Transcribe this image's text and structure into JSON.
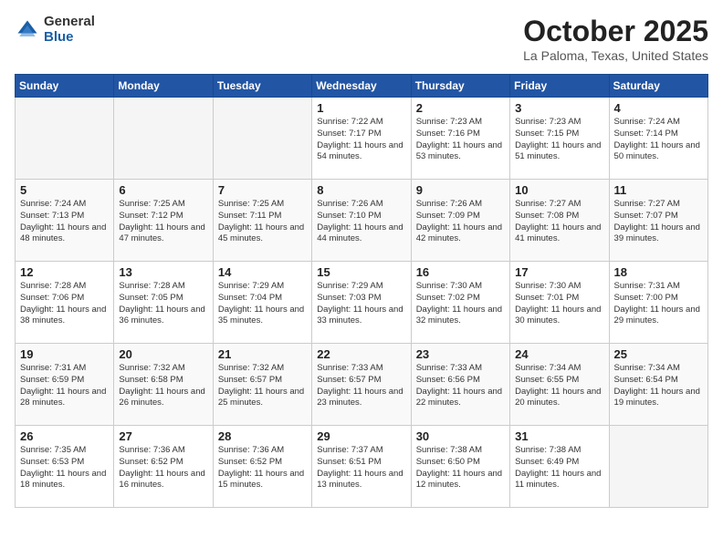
{
  "logo": {
    "general": "General",
    "blue": "Blue"
  },
  "title": {
    "month": "October 2025",
    "location": "La Paloma, Texas, United States"
  },
  "weekdays": [
    "Sunday",
    "Monday",
    "Tuesday",
    "Wednesday",
    "Thursday",
    "Friday",
    "Saturday"
  ],
  "weeks": [
    [
      {
        "day": "",
        "empty": true
      },
      {
        "day": "",
        "empty": true
      },
      {
        "day": "",
        "empty": true
      },
      {
        "day": "1",
        "sunrise": "7:22 AM",
        "sunset": "7:17 PM",
        "daylight": "11 hours and 54 minutes."
      },
      {
        "day": "2",
        "sunrise": "7:23 AM",
        "sunset": "7:16 PM",
        "daylight": "11 hours and 53 minutes."
      },
      {
        "day": "3",
        "sunrise": "7:23 AM",
        "sunset": "7:15 PM",
        "daylight": "11 hours and 51 minutes."
      },
      {
        "day": "4",
        "sunrise": "7:24 AM",
        "sunset": "7:14 PM",
        "daylight": "11 hours and 50 minutes."
      }
    ],
    [
      {
        "day": "5",
        "sunrise": "7:24 AM",
        "sunset": "7:13 PM",
        "daylight": "11 hours and 48 minutes."
      },
      {
        "day": "6",
        "sunrise": "7:25 AM",
        "sunset": "7:12 PM",
        "daylight": "11 hours and 47 minutes."
      },
      {
        "day": "7",
        "sunrise": "7:25 AM",
        "sunset": "7:11 PM",
        "daylight": "11 hours and 45 minutes."
      },
      {
        "day": "8",
        "sunrise": "7:26 AM",
        "sunset": "7:10 PM",
        "daylight": "11 hours and 44 minutes."
      },
      {
        "day": "9",
        "sunrise": "7:26 AM",
        "sunset": "7:09 PM",
        "daylight": "11 hours and 42 minutes."
      },
      {
        "day": "10",
        "sunrise": "7:27 AM",
        "sunset": "7:08 PM",
        "daylight": "11 hours and 41 minutes."
      },
      {
        "day": "11",
        "sunrise": "7:27 AM",
        "sunset": "7:07 PM",
        "daylight": "11 hours and 39 minutes."
      }
    ],
    [
      {
        "day": "12",
        "sunrise": "7:28 AM",
        "sunset": "7:06 PM",
        "daylight": "11 hours and 38 minutes."
      },
      {
        "day": "13",
        "sunrise": "7:28 AM",
        "sunset": "7:05 PM",
        "daylight": "11 hours and 36 minutes."
      },
      {
        "day": "14",
        "sunrise": "7:29 AM",
        "sunset": "7:04 PM",
        "daylight": "11 hours and 35 minutes."
      },
      {
        "day": "15",
        "sunrise": "7:29 AM",
        "sunset": "7:03 PM",
        "daylight": "11 hours and 33 minutes."
      },
      {
        "day": "16",
        "sunrise": "7:30 AM",
        "sunset": "7:02 PM",
        "daylight": "11 hours and 32 minutes."
      },
      {
        "day": "17",
        "sunrise": "7:30 AM",
        "sunset": "7:01 PM",
        "daylight": "11 hours and 30 minutes."
      },
      {
        "day": "18",
        "sunrise": "7:31 AM",
        "sunset": "7:00 PM",
        "daylight": "11 hours and 29 minutes."
      }
    ],
    [
      {
        "day": "19",
        "sunrise": "7:31 AM",
        "sunset": "6:59 PM",
        "daylight": "11 hours and 28 minutes."
      },
      {
        "day": "20",
        "sunrise": "7:32 AM",
        "sunset": "6:58 PM",
        "daylight": "11 hours and 26 minutes."
      },
      {
        "day": "21",
        "sunrise": "7:32 AM",
        "sunset": "6:57 PM",
        "daylight": "11 hours and 25 minutes."
      },
      {
        "day": "22",
        "sunrise": "7:33 AM",
        "sunset": "6:57 PM",
        "daylight": "11 hours and 23 minutes."
      },
      {
        "day": "23",
        "sunrise": "7:33 AM",
        "sunset": "6:56 PM",
        "daylight": "11 hours and 22 minutes."
      },
      {
        "day": "24",
        "sunrise": "7:34 AM",
        "sunset": "6:55 PM",
        "daylight": "11 hours and 20 minutes."
      },
      {
        "day": "25",
        "sunrise": "7:34 AM",
        "sunset": "6:54 PM",
        "daylight": "11 hours and 19 minutes."
      }
    ],
    [
      {
        "day": "26",
        "sunrise": "7:35 AM",
        "sunset": "6:53 PM",
        "daylight": "11 hours and 18 minutes."
      },
      {
        "day": "27",
        "sunrise": "7:36 AM",
        "sunset": "6:52 PM",
        "daylight": "11 hours and 16 minutes."
      },
      {
        "day": "28",
        "sunrise": "7:36 AM",
        "sunset": "6:52 PM",
        "daylight": "11 hours and 15 minutes."
      },
      {
        "day": "29",
        "sunrise": "7:37 AM",
        "sunset": "6:51 PM",
        "daylight": "11 hours and 13 minutes."
      },
      {
        "day": "30",
        "sunrise": "7:38 AM",
        "sunset": "6:50 PM",
        "daylight": "11 hours and 12 minutes."
      },
      {
        "day": "31",
        "sunrise": "7:38 AM",
        "sunset": "6:49 PM",
        "daylight": "11 hours and 11 minutes."
      },
      {
        "day": "",
        "empty": true
      }
    ]
  ]
}
